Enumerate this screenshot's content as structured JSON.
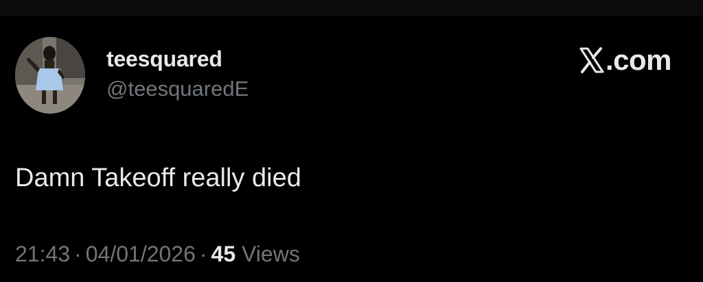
{
  "tweet": {
    "author": {
      "display_name": "teesquared",
      "handle": "@teesquaredE",
      "avatar": "profile-photo"
    },
    "brand": {
      "icon": "x-logo-icon",
      "label": ".com"
    },
    "text": "Damn Takeoff really died",
    "meta": {
      "time": "21:43",
      "separator": "·",
      "date": "04/01/2026",
      "views_count": "45",
      "views_label": "Views"
    }
  },
  "colors": {
    "background": "#000000",
    "primary_text": "#e7e9ea",
    "secondary_text": "#71767b"
  }
}
